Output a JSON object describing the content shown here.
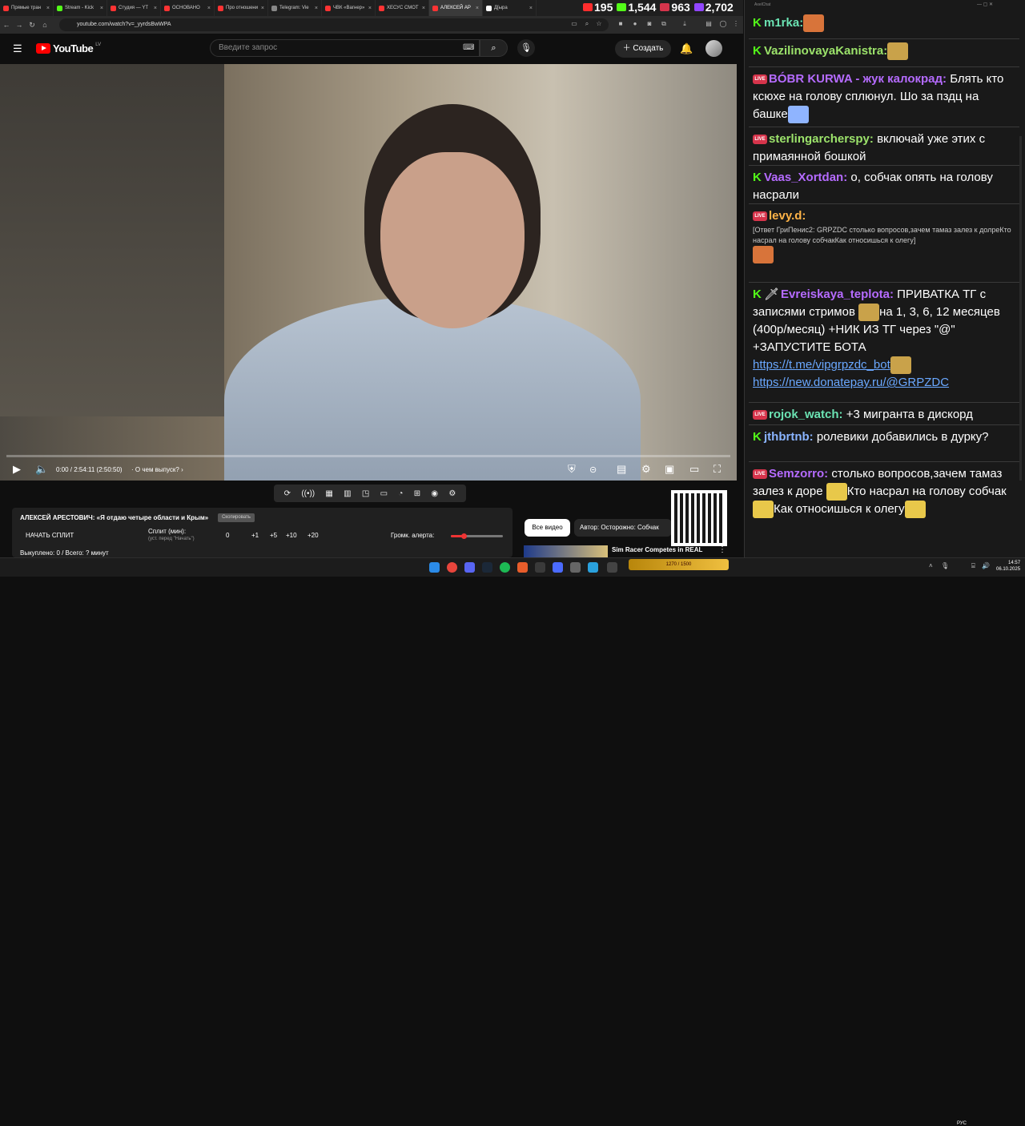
{
  "browser": {
    "tabs": [
      {
        "label": "Прямые тран",
        "color": "#ff3333"
      },
      {
        "label": "Stream - Kick",
        "color": "#53fc18"
      },
      {
        "label": "Студия — YT",
        "color": "#ff3333"
      },
      {
        "label": "ОСНОВАНО",
        "color": "#ff3333"
      },
      {
        "label": "Про отношени",
        "color": "#ff3333"
      },
      {
        "label": "Telegram: Vie",
        "color": "#888888"
      },
      {
        "label": "ЧВК «Вагнер»",
        "color": "#ff3333"
      },
      {
        "label": "ХЕСУС СМОТ",
        "color": "#ff3333"
      },
      {
        "label": "АЛЕКСЕЙ АР",
        "color": "#ff3333"
      },
      {
        "label": "Д[ыра",
        "color": "#ffffff"
      }
    ],
    "url": "youtube.com/watch?v=_yyrdsBwWPA",
    "counters": [
      {
        "value": "195",
        "color": "#ff2d2d"
      },
      {
        "value": "1,544",
        "color": "#53fc18"
      },
      {
        "value": "963",
        "color": "#d6344b"
      },
      {
        "value": "2,702",
        "color": "#9146ff"
      }
    ]
  },
  "youtube": {
    "logo": "YouTube",
    "region": "LV",
    "search_placeholder": "Введите запрос",
    "create_label": "Создать",
    "time": "0:00 / 2:54:11 (2:50:50)",
    "chapter": "· О чем выпуск?",
    "progress_fraction": 0.0
  },
  "panel": {
    "title": "АЛЕКСЕЙ АРЕСТОВИЧ: «Я отдаю четыре области и Крым»",
    "badge": "Скопировать",
    "start_split": "НАЧАТЬ СПЛИТ",
    "split_label": "Сплит (мин):",
    "split_hint": "(уст. перед \"Начать\")",
    "split_value": "0",
    "increments": [
      "+1",
      "+5",
      "+10",
      "+20"
    ],
    "volume_label": "Громк. алерта:",
    "volume_fraction": 0.25,
    "bought": "Выкуплено: 0 / Всего: ? минут"
  },
  "recommendations": {
    "all_label": "Все видео",
    "author_label": "Автор: Осторожно: Собчак",
    "video_title": "Sim Racer Competes in REAL"
  },
  "chat": {
    "title": "AxelChat",
    "messages": [
      {
        "platform": "kick",
        "user": "m1rka:",
        "text": "",
        "user_color": "u-teal",
        "emote": true
      },
      {
        "platform": "kick",
        "user": "VazilinovayaKanistra:",
        "text": "",
        "user_color": "u-green",
        "emote": true
      },
      {
        "platform": "live",
        "user": "BÓBR KURWA - жук калокрад:",
        "text": "Блять кто ксюхе на голову сплюнул. Шо за пздц на башке",
        "user_color": "u-purple",
        "emote": true
      },
      {
        "platform": "live",
        "user": "sterlingarcherspy:",
        "text": "включай уже этих с примаянной бошкой",
        "user_color": "u-green"
      },
      {
        "platform": "kick",
        "user": "Vaas_Xortdan:",
        "text": "о, собчак опять на голову насрали",
        "user_color": "u-purple"
      },
      {
        "platform": "live",
        "user": "levy.d:",
        "text": "",
        "user_color": "u-orange",
        "reply": "[Ответ ГриПенис2: GRPZDC столько вопросов,зачем тамаз залез к долреКто насрал на голову собчакКак относишься к олегу]",
        "emote": true
      },
      {
        "platform": "kick",
        "user": "Evreiskaya_teplota:",
        "text": "ПРИВАТКА ТГ с записями стримов",
        "text2": "на 1, 3, 6, 12 месяцев (400р/месяц) +НИК ИЗ ТГ через \"@\" +ЗАПУСТИТЕ БОТА",
        "link1": "https://t.me/vipgrpzdc_bot",
        "link2": "https://new.donatepay.ru/@GRPZDC",
        "user_color": "u-purple"
      },
      {
        "platform": "live",
        "user": "rojok_watch:",
        "text": "+3 мигранта в дискорд",
        "user_color": "u-teal"
      },
      {
        "platform": "kick",
        "user": "jthbrtnb:",
        "text": "ролевики добавились в дурку?",
        "user_color": "u-blue"
      },
      {
        "platform": "live",
        "user": "Semzorro:",
        "text": "столько вопросов,зачем тамаз залез к доре",
        "text2": "Кто насрал на голову собчак",
        "text3": "Как относишься к олегу",
        "user_color": "u-purple"
      }
    ]
  },
  "taskbar": {
    "game_label": "1270 / 1500",
    "lang": "РУС",
    "time": "14:57",
    "date": "06.10.2025"
  }
}
